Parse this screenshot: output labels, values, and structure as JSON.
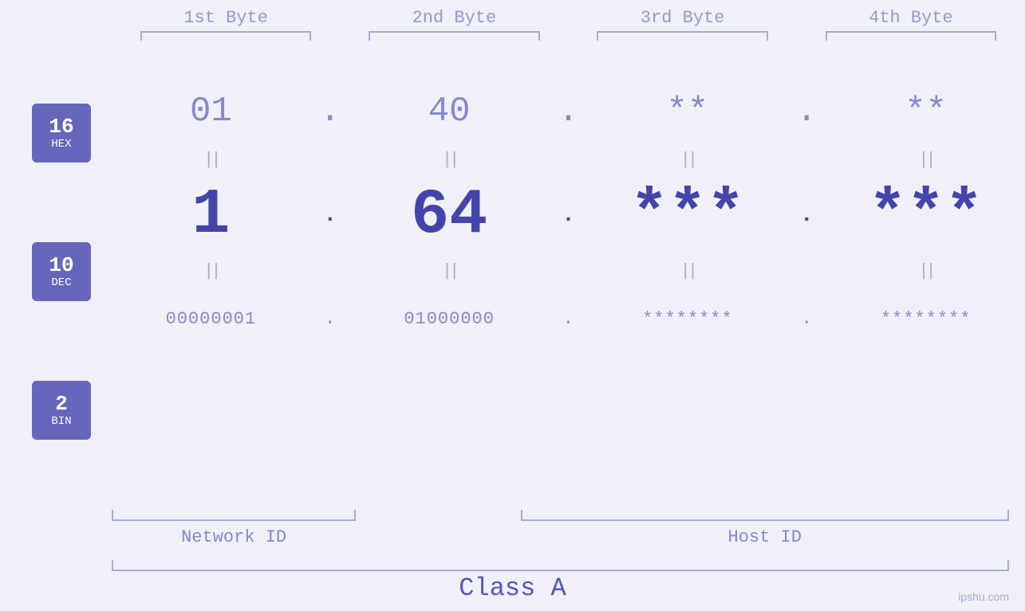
{
  "header": {
    "byte_labels": [
      "1st Byte",
      "2nd Byte",
      "3rd Byte",
      "4th Byte"
    ]
  },
  "badges": [
    {
      "number": "16",
      "base": "HEX"
    },
    {
      "number": "10",
      "base": "DEC"
    },
    {
      "number": "2",
      "base": "BIN"
    }
  ],
  "hex_row": {
    "values": [
      "01",
      "40",
      "**",
      "**"
    ],
    "dots": [
      ".",
      ".",
      "."
    ]
  },
  "dec_row": {
    "values": [
      "1",
      "64",
      "***",
      "***"
    ],
    "dots": [
      ".",
      ".",
      "."
    ]
  },
  "bin_row": {
    "values": [
      "00000001",
      "01000000",
      "********",
      "********"
    ],
    "dots": [
      ".",
      ".",
      "."
    ]
  },
  "eq_signs": [
    "||",
    "||",
    "||",
    "||"
  ],
  "labels": {
    "network_id": "Network ID",
    "host_id": "Host ID",
    "class": "Class A"
  },
  "watermark": "ipshu.com"
}
